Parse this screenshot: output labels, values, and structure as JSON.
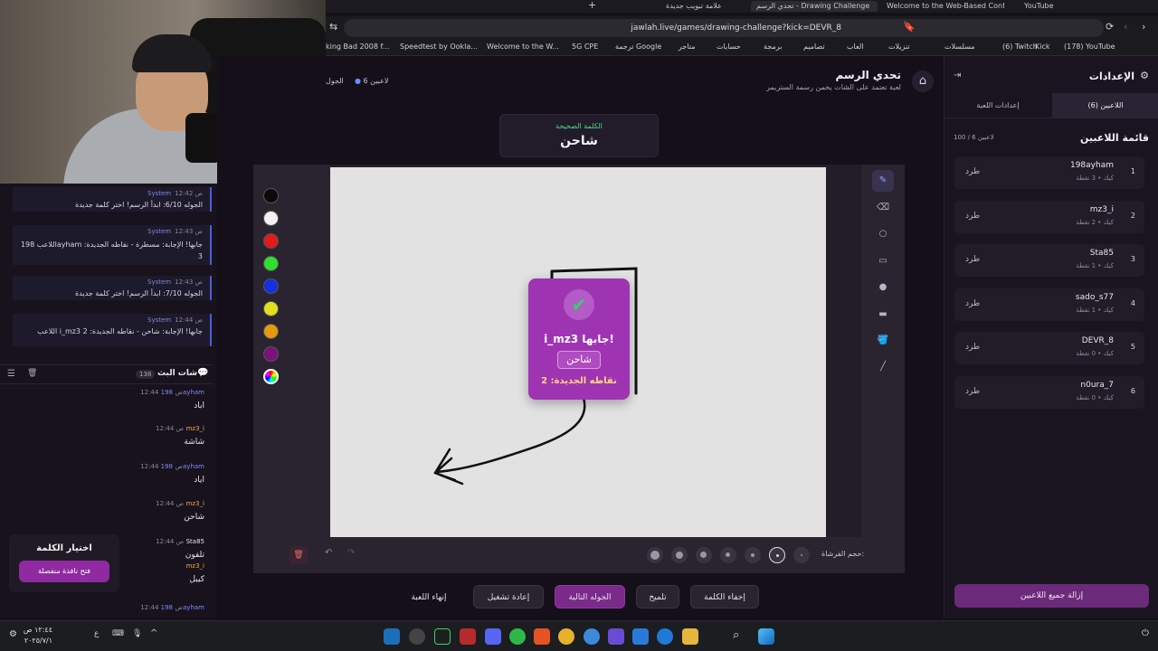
{
  "browser": {
    "tabs": [
      {
        "label": "YouTube"
      },
      {
        "label": "Welcome to the Web-Based Config..."
      },
      {
        "label": "تحدي الرسم - Drawing Challenge"
      },
      {
        "label": "علامة تبويب جديدة"
      }
    ],
    "url": "jawlah.live/games/drawing-challenge?kick=DEVR_8",
    "bookmarks": [
      "(178) YouTube",
      "Kick",
      "(6) Twitch",
      "مسلسلات",
      "تنزيلات",
      "العاب",
      "تصاميم",
      "برمجة",
      "حسابات",
      "متاجر",
      "ترجمة Google",
      "5G CPE",
      "Welcome to the W...",
      "Speedtest by Ookla...",
      "king Bad 2008 f..."
    ]
  },
  "chat": {
    "system_messages": [
      {
        "author": "System",
        "time": "12:42 ص",
        "text": "الجوله 6/10: ابدأ الرسم! اختر كلمة جديدة"
      },
      {
        "author": "System",
        "time": "12:43 ص",
        "text": "اللاعب 198ayham جابها! الإجابة: مسطرة - نقاطه الجديدة: 3"
      },
      {
        "author": "System",
        "time": "12:43 ص",
        "text": "الجوله 7/10: ابدأ الرسم! اختر كلمة جديدة"
      },
      {
        "author": "System",
        "time": "12:44 ص",
        "text": "اللاعب i_mz3 جابها! الإجابة: شاحن - نقاطه الجديدة: 2"
      }
    ],
    "header_title": "شات البث",
    "header_count": "138",
    "messages": [
      {
        "name": "198ayham",
        "color": "#7f8bff",
        "time": "12:44 ص",
        "text": "اباد"
      },
      {
        "name": "mz3_i",
        "color": "#f0a94a",
        "time": "12:44 ص",
        "text": "شاشة"
      },
      {
        "name": "198ayham",
        "color": "#7f8bff",
        "time": "12:44 ص",
        "text": "اياد"
      },
      {
        "name": "mz3_i",
        "color": "#f0a94a",
        "time": "12:44 ص",
        "text": "شاحن"
      },
      {
        "name": "Sta85",
        "color": "#e6e3ec",
        "time": "12:44 ص",
        "text": "تلفون"
      },
      {
        "name": "mz3_i",
        "color": "#f0a94a",
        "time": "",
        "text": "كيبل"
      },
      {
        "name": "198ayham",
        "color": "#7f8bff",
        "time": "12:44 ص",
        "text": ""
      }
    ],
    "pick_word_title": "اختيار الكلمة",
    "pick_word_button": "فتح نافذة منفصلة"
  },
  "game": {
    "title": "تحدي الرسم",
    "subtitle": "لعبة تعتمد على الشات يخمن رسمة الستريمر",
    "players_count": "6 لاعبين",
    "round_label": "الجول",
    "correct_word_label": "الكلمة الصحيحة",
    "correct_word": "شاحن",
    "overlay": {
      "winner": "i_mz3 جابها!",
      "word": "شاحن",
      "points": "نقاطه الجديدة: 2"
    },
    "brush_size_label": "حجم الفرشاة:",
    "controls": {
      "end_game": "إنهاء اللعبة",
      "restart": "إعادة تشغيل",
      "next_round": "الجوله التالية",
      "hint": "تلميح",
      "hide_word": "إخفاء الكلمة"
    },
    "colors": [
      "#0a0a0a",
      "#f2f2f2",
      "#e01b1b",
      "#2ee02e",
      "#1430e0",
      "#e0e020",
      "#e39b0c",
      "#7a127a"
    ]
  },
  "settings": {
    "title": "الإعدادات",
    "tab_players": "اللاعبين (6)",
    "tab_game_settings": "إعدادات اللعبة",
    "list_title": "قائمة اللاعبين",
    "list_count": "100 / 6 لاعبين",
    "kick_label": "طرد",
    "players": [
      {
        "idx": "1",
        "name": "198ayham",
        "stats": "كيك • 3 نقطة"
      },
      {
        "idx": "2",
        "name": "mz3_i",
        "stats": "كيك • 2 نقطة"
      },
      {
        "idx": "3",
        "name": "Sta85",
        "stats": "كيك • 1 نقطة"
      },
      {
        "idx": "4",
        "name": "sado_s77",
        "stats": "كيك • 1 نقطة"
      },
      {
        "idx": "5",
        "name": "DEVR_8",
        "stats": "كيك • 0 نقطة"
      },
      {
        "idx": "6",
        "name": "n0ura_7",
        "stats": "كيك • 0 نقطة"
      }
    ],
    "clear_all": "إزالة جميع اللاعبين"
  },
  "taskbar": {
    "time": "١٢:٤٤ ص",
    "date": "٢٠٢٥/٧/١"
  }
}
